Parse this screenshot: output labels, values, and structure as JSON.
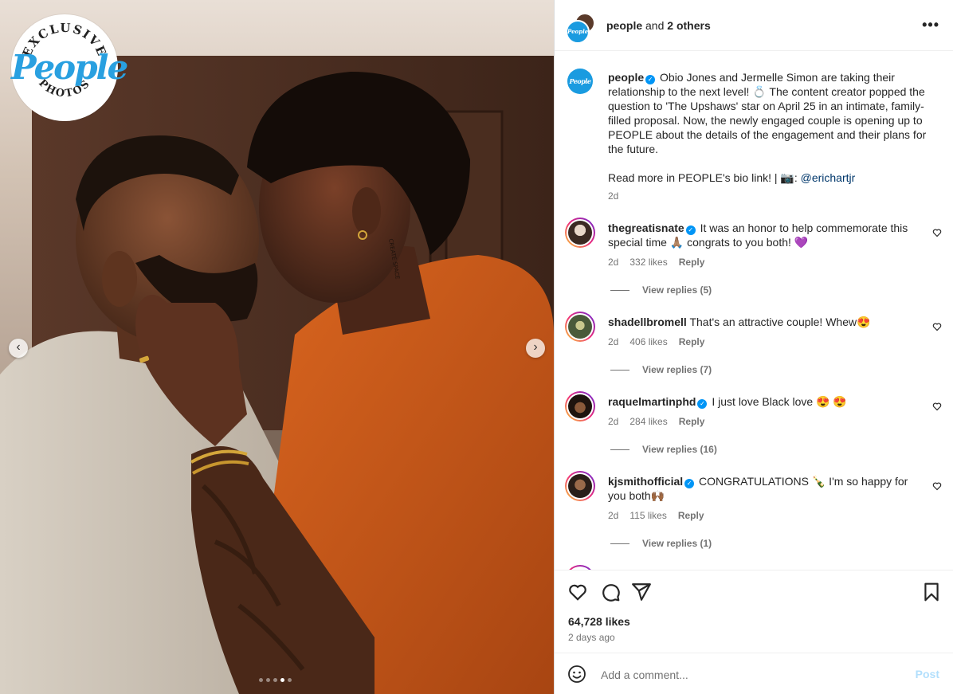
{
  "photo": {
    "badge_top_text": "EXCLUSIVE",
    "badge_brand": "People",
    "badge_bottom_text": "PHOTOS",
    "tattoo_text": "CREATE SPACE",
    "prev_icon": "‹",
    "next_icon": "›",
    "slide_count": 5,
    "active_slide": 4
  },
  "header": {
    "username": "people",
    "others_text": "and",
    "others_count": "2 others",
    "more_icon": "•••",
    "avatar_text": "People"
  },
  "caption": {
    "username": "people",
    "verified_icon": "✓",
    "text": "Obio Jones and Jermelle Simon are taking their relationship to the next level! 💍 The content creator popped the question to 'The Upshaws' star on April 25 in an intimate, family-filled proposal. Now, the newly engaged couple is opening up to PEOPLE about the details of the engagement and their plans for the future.",
    "read_more": "Read more in PEOPLE's bio link! | 📷: ",
    "mention": "@erichartjr",
    "time": "2d"
  },
  "comments": [
    {
      "username": "thegreatisnate",
      "verified": true,
      "text": "It was an honor to help commemorate this special time 🙏🏽 congrats to you both! 💜",
      "time": "2d",
      "likes": "332 likes",
      "reply_label": "Reply",
      "view_replies": "View replies (5)"
    },
    {
      "username": "shadellbromell",
      "verified": false,
      "text": "That's an attractive couple! Whew😍",
      "time": "2d",
      "likes": "406 likes",
      "reply_label": "Reply",
      "view_replies": "View replies (7)"
    },
    {
      "username": "raquelmartinphd",
      "verified": true,
      "text": "I just love Black love 😍 😍",
      "time": "2d",
      "likes": "284 likes",
      "reply_label": "Reply",
      "view_replies": "View replies (16)"
    },
    {
      "username": "kjsmithofficial",
      "verified": true,
      "text": "CONGRATULATIONS 🍾 I'm so happy for you both🙌🏾",
      "time": "2d",
      "likes": "115 likes",
      "reply_label": "Reply",
      "view_replies": "View replies (1)"
    }
  ],
  "actions": {
    "like_icon": "heart-icon",
    "comment_icon": "comment-icon",
    "share_icon": "share-icon",
    "save_icon": "bookmark-icon",
    "likes_count": "64,728 likes",
    "date": "2 days ago"
  },
  "add_comment": {
    "emoji_icon": "emoji-icon",
    "placeholder": "Add a comment...",
    "post_label": "Post"
  },
  "colors": {
    "brand_blue": "#1a9be0",
    "verified_blue": "#0095f6",
    "post_disabled": "#b2dffc",
    "shirt_orange": "#c2541a"
  }
}
